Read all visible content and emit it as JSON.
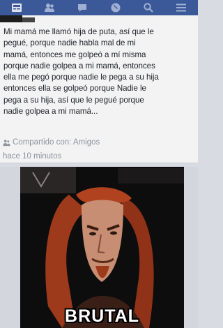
{
  "nav": {
    "icons": [
      "news-feed-icon",
      "friends-icon",
      "messages-icon",
      "globe-icon",
      "search-icon",
      "menu-icon"
    ]
  },
  "post": {
    "text": "Mi mamá me llamó hija de puta, así que le\npegué, porque nadie habla mal de mi\nmamá, entonces me golpeó a mí misma\nporque nadie golpea a mi mamá, entonces\nella me pegó porque nadie le pega a su hija\nentonces ella se golpeó porque Nadie le\npega a su hija, así que le pegué porque\nnadie golpea a mi mamá...",
    "shared_with": "Compartido con: Amigos",
    "time": "hace 10 minutos"
  },
  "meme": {
    "caption": "BRUTAL"
  },
  "colors": {
    "topbar": "#3b5998",
    "meta_text": "#8d949e"
  }
}
